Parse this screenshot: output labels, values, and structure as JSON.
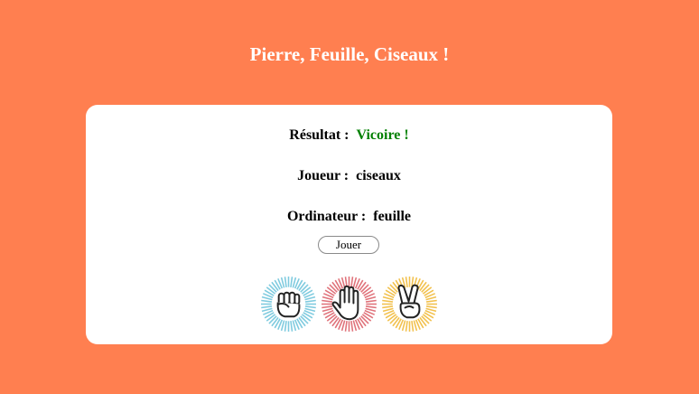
{
  "header": {
    "title": "Pierre, Feuille, Ciseaux !"
  },
  "result": {
    "label": "Résultat :",
    "value": "Vicoire !"
  },
  "player": {
    "label": "Joueur :",
    "value": "ciseaux"
  },
  "computer": {
    "label": "Ordinateur :",
    "value": "feuille"
  },
  "play_button": {
    "label": "Jouer"
  },
  "choices": [
    {
      "name": "pierre",
      "icon": "rock-fist-icon",
      "color": "#7fcbdf"
    },
    {
      "name": "feuille",
      "icon": "paper-hand-icon",
      "color": "#e0737b"
    },
    {
      "name": "ciseaux",
      "icon": "scissors-hand-icon",
      "color": "#f2c14e"
    }
  ],
  "colors": {
    "background": "#ff7f50",
    "win_text": "#008000"
  }
}
